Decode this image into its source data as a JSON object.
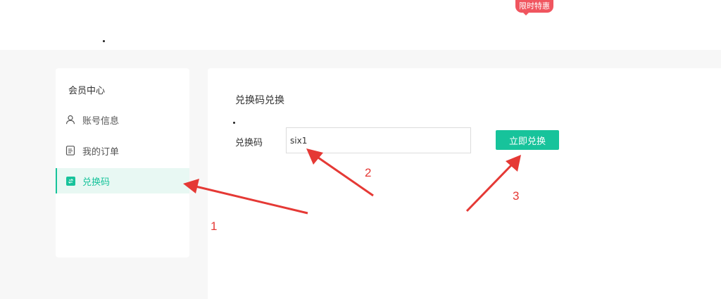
{
  "header": {
    "promo_badge": "限时特惠"
  },
  "sidebar": {
    "title": "会员中心",
    "items": [
      {
        "label": "账号信息",
        "icon": "user-icon"
      },
      {
        "label": "我的订单",
        "icon": "order-list-icon"
      },
      {
        "label": "兑换码",
        "icon": "redeem-icon",
        "active": true
      }
    ]
  },
  "main": {
    "title": "兑换码兑换",
    "code_label": "兑换码",
    "code_value": "six1",
    "redeem_button": "立即兑换"
  },
  "annotations": {
    "labels": [
      "1",
      "2",
      "3"
    ],
    "color": "#e53935"
  },
  "colors": {
    "accent": "#17c39b",
    "active_bg": "#e8f8f3",
    "promo": "#f0555f"
  }
}
